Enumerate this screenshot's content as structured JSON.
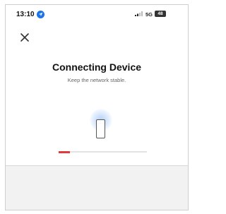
{
  "status_bar": {
    "time": "13:10",
    "location_icon": "location-arrow-icon",
    "signal_icon": "cell-signal-icon",
    "network": "5G",
    "battery_level": "48"
  },
  "header": {
    "close_icon": "close-icon"
  },
  "main": {
    "title": "Connecting Device",
    "subtitle": "Keep the network stable.",
    "device_icon": "phone-icon",
    "progress": 0.13
  },
  "colors": {
    "accent": "#e23a3a",
    "location": "#1a73e8"
  }
}
